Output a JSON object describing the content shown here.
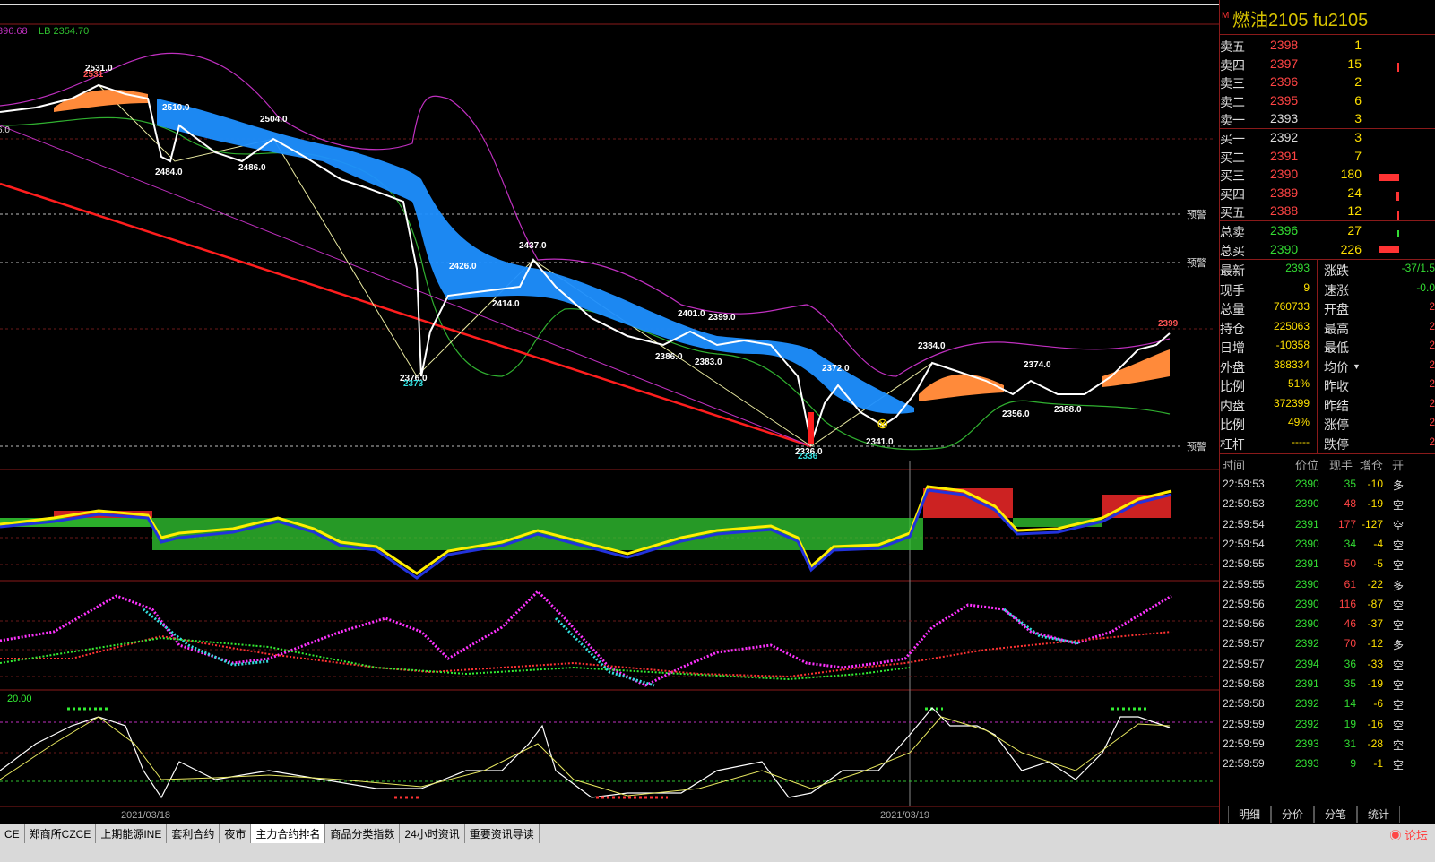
{
  "indicator_header": {
    "left": "396.68",
    "lb": "LB 2354.70"
  },
  "chart_labels": {
    "prices": [
      "2531.0",
      "2531",
      "2510.0",
      "2504.0",
      "2486.0",
      "2484.0",
      "2437.0",
      "2426.0",
      "2414.0",
      "2376.0",
      "2373",
      "2401.0",
      "2399.0",
      "2386.0",
      "2383.0",
      "2372.0",
      "2336.0",
      "2336",
      "2341.0",
      "2384.0",
      "2374.0",
      "2356.0",
      "2388.0",
      "2399"
    ],
    "left_edge": "6.0",
    "warn": "预警",
    "osc_level": "20.00",
    "dates": [
      "2021/03/18",
      "2021/03/19"
    ]
  },
  "quote": {
    "title": "燃油2105  fu2105",
    "asks": [
      {
        "label": "卖五",
        "price": "2398",
        "vol": "1"
      },
      {
        "label": "卖四",
        "price": "2397",
        "vol": "15"
      },
      {
        "label": "卖三",
        "price": "2396",
        "vol": "2"
      },
      {
        "label": "卖二",
        "price": "2395",
        "vol": "6"
      },
      {
        "label": "卖一",
        "price": "2393",
        "vol": "3"
      }
    ],
    "bids": [
      {
        "label": "买一",
        "price": "2392",
        "vol": "3"
      },
      {
        "label": "买二",
        "price": "2391",
        "vol": "7"
      },
      {
        "label": "买三",
        "price": "2390",
        "vol": "180"
      },
      {
        "label": "买四",
        "price": "2389",
        "vol": "24"
      },
      {
        "label": "买五",
        "price": "2388",
        "vol": "12"
      }
    ],
    "totals": [
      {
        "label": "总卖",
        "price": "2396",
        "vol": "27"
      },
      {
        "label": "总买",
        "price": "2390",
        "vol": "226"
      }
    ],
    "stats_left": [
      {
        "label": "最新",
        "value": "2393"
      },
      {
        "label": "现手",
        "value": "9"
      },
      {
        "label": "总量",
        "value": "760733"
      },
      {
        "label": "持仓",
        "value": "225063"
      },
      {
        "label": "日增",
        "value": "-10358"
      },
      {
        "label": "外盘",
        "value": "388334"
      },
      {
        "label": "比例",
        "value": "51%"
      },
      {
        "label": "内盘",
        "value": "372399"
      },
      {
        "label": "比例",
        "value": "49%"
      },
      {
        "label": "杠杆",
        "value": "-----"
      }
    ],
    "stats_right": [
      {
        "label": "涨跌",
        "value": "-37/1.5"
      },
      {
        "label": "速涨",
        "value": "-0.0"
      },
      {
        "label": "开盘",
        "value": "2"
      },
      {
        "label": "最高",
        "value": "2"
      },
      {
        "label": "最低",
        "value": "2"
      },
      {
        "label": "均价",
        "value": "2"
      },
      {
        "label": "昨收",
        "value": "2"
      },
      {
        "label": "昨结",
        "value": "2"
      },
      {
        "label": "涨停",
        "value": "2"
      },
      {
        "label": "跌停",
        "value": "2"
      }
    ]
  },
  "trades": {
    "headers": [
      "时间",
      "价位",
      "现手",
      "增仓",
      "开"
    ],
    "rows": [
      {
        "time": "22:59:53",
        "price": "2390",
        "vol": "35",
        "chg": "-10",
        "type": "多"
      },
      {
        "time": "22:59:53",
        "price": "2390",
        "vol": "48",
        "chg": "-19",
        "type": "空"
      },
      {
        "time": "22:59:54",
        "price": "2391",
        "vol": "177",
        "chg": "-127",
        "type": "空"
      },
      {
        "time": "22:59:54",
        "price": "2390",
        "vol": "34",
        "chg": "-4",
        "type": "空"
      },
      {
        "time": "22:59:55",
        "price": "2391",
        "vol": "50",
        "chg": "-5",
        "type": "空"
      },
      {
        "time": "22:59:55",
        "price": "2390",
        "vol": "61",
        "chg": "-22",
        "type": "多"
      },
      {
        "time": "22:59:56",
        "price": "2390",
        "vol": "116",
        "chg": "-87",
        "type": "空"
      },
      {
        "time": "22:59:56",
        "price": "2390",
        "vol": "46",
        "chg": "-37",
        "type": "空"
      },
      {
        "time": "22:59:57",
        "price": "2392",
        "vol": "70",
        "chg": "-12",
        "type": "多"
      },
      {
        "time": "22:59:57",
        "price": "2394",
        "vol": "36",
        "chg": "-33",
        "type": "空"
      },
      {
        "time": "22:59:58",
        "price": "2391",
        "vol": "35",
        "chg": "-19",
        "type": "空"
      },
      {
        "time": "22:59:58",
        "price": "2392",
        "vol": "14",
        "chg": "-6",
        "type": "空"
      },
      {
        "time": "22:59:59",
        "price": "2392",
        "vol": "19",
        "chg": "-16",
        "type": "空"
      },
      {
        "time": "22:59:59",
        "price": "2393",
        "vol": "31",
        "chg": "-28",
        "type": "空"
      },
      {
        "time": "22:59:59",
        "price": "2393",
        "vol": "9",
        "chg": "-1",
        "type": "空"
      }
    ]
  },
  "side_tabs": [
    "明细",
    "分价",
    "分笔",
    "统计"
  ],
  "bottom_tabs": [
    "CE",
    "郑商所CZCE",
    "上期能源INE",
    "套利合约",
    "夜市",
    "主力合约排名",
    "商品分类指数",
    "24小时资讯",
    "重要资讯导读"
  ],
  "bottom_right": "论坛",
  "colors": {
    "up": "#ff3b3b",
    "down": "#33dd33",
    "accent": "#d8c400",
    "grid": "#8a1a1a"
  }
}
